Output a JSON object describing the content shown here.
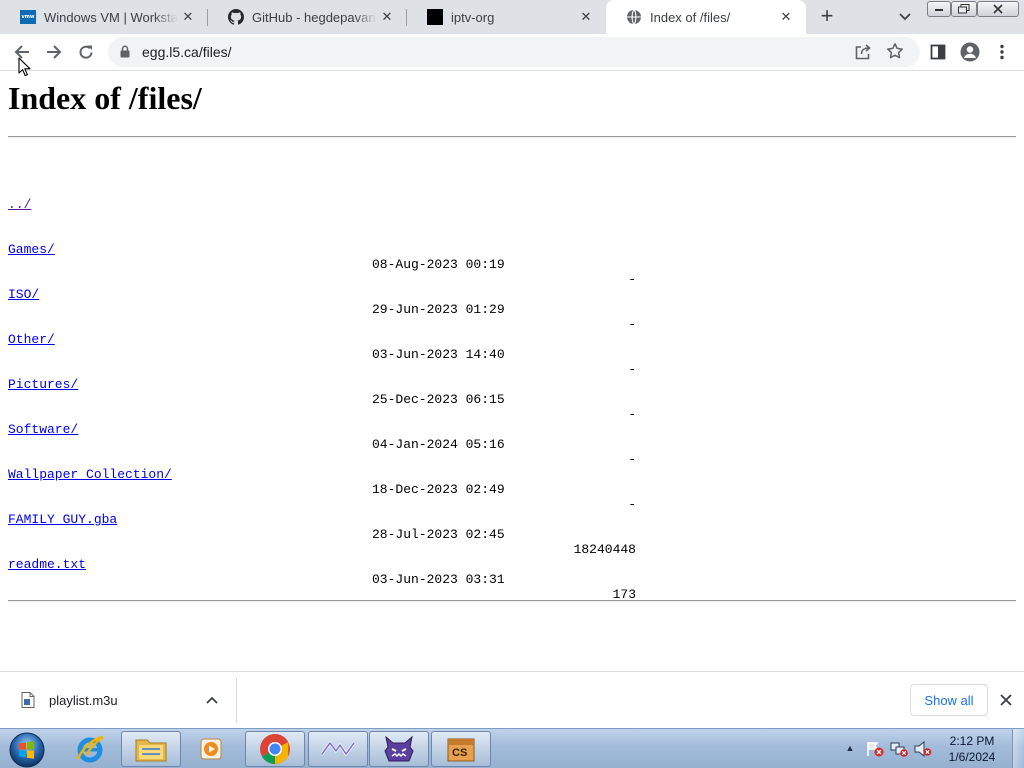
{
  "browser": {
    "tabs": [
      {
        "title": "Windows VM | Workstation",
        "favicon": "vmware-icon",
        "favicon_text": "vmw"
      },
      {
        "title": "GitHub - hegdepavankumar",
        "favicon": "github-icon"
      },
      {
        "title": "iptv-org",
        "favicon": "black-square-icon"
      },
      {
        "title": "Index of /files/",
        "favicon": "globe-icon",
        "active": true
      }
    ],
    "new_tab_label": "+",
    "url": "egg.l5.ca/files/"
  },
  "page": {
    "heading": "Index of /files/",
    "entries": [
      {
        "name": "../",
        "date": "",
        "size": ""
      },
      {
        "name": "Games/",
        "date": "08-Aug-2023 00:19",
        "size": "-"
      },
      {
        "name": "ISO/",
        "date": "29-Jun-2023 01:29",
        "size": "-"
      },
      {
        "name": "Other/",
        "date": "03-Jun-2023 14:40",
        "size": "-"
      },
      {
        "name": "Pictures/",
        "date": "25-Dec-2023 06:15",
        "size": "-"
      },
      {
        "name": "Software/",
        "date": "04-Jan-2024 05:16",
        "size": "-"
      },
      {
        "name": "Wallpaper Collection/",
        "date": "18-Dec-2023 02:49",
        "size": "-"
      },
      {
        "name": "FAMILY GUY.gba",
        "date": "28-Jul-2023 02:45",
        "size": "18240448"
      },
      {
        "name": "readme.txt",
        "date": "03-Jun-2023 03:31",
        "size": "173"
      }
    ]
  },
  "downloads": {
    "file_name": "playlist.m3u",
    "show_all_label": "Show all"
  },
  "taskbar": {
    "apps": [
      {
        "name": "internet-explorer-icon",
        "open": false
      },
      {
        "name": "file-explorer-icon",
        "open": true
      },
      {
        "name": "media-player-icon",
        "open": false
      },
      {
        "name": "chrome-icon",
        "open": true
      },
      {
        "name": "vpn-app-icon",
        "open": true
      },
      {
        "name": "monster-app-icon",
        "open": true
      },
      {
        "name": "cs-app-icon",
        "open": true,
        "label": "CS"
      }
    ],
    "clock_time": "2:12 PM",
    "clock_date": "1/6/2024"
  },
  "colors": {
    "link": "#0000ee",
    "visited_link": "#551a8b",
    "tabstrip": "#dee1e6",
    "accent": "#1a73e8"
  }
}
